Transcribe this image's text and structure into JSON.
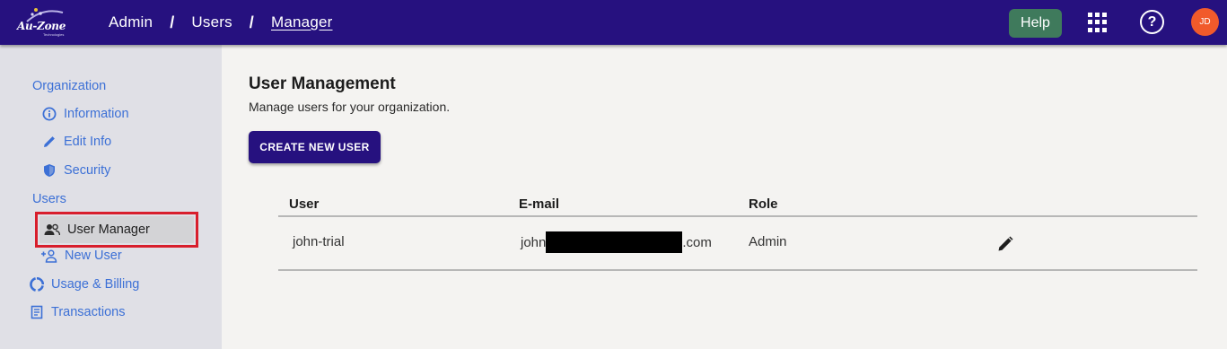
{
  "app": {
    "logo_text": "Au-Zone",
    "logo_sub": "Technologies"
  },
  "breadcrumb": {
    "items": [
      "Admin",
      "Users",
      "Manager"
    ],
    "separator": "/"
  },
  "header": {
    "help_label": "Help",
    "question_glyph": "?",
    "avatar_initials": "JD",
    "colors": {
      "bar": "#26117f",
      "help": "#3f7a5c",
      "avatar": "#f15a2b"
    }
  },
  "sidebar": {
    "groups": [
      {
        "label": "Organization",
        "items": [
          {
            "label": "Information",
            "icon": "info-circle-icon"
          },
          {
            "label": "Edit Info",
            "icon": "pencil-icon"
          },
          {
            "label": "Security",
            "icon": "shield-icon"
          }
        ]
      },
      {
        "label": "Users",
        "items": [
          {
            "label": "User Manager",
            "icon": "people-icon",
            "active": true
          },
          {
            "label": "New User",
            "icon": "add-person-icon"
          }
        ]
      }
    ],
    "extra_items": [
      {
        "label": "Usage & Billing",
        "icon": "donut-chart-icon"
      },
      {
        "label": "Transactions",
        "icon": "receipt-icon"
      }
    ]
  },
  "main": {
    "title": "User Management",
    "subtitle": "Manage users for your organization.",
    "create_button": "CREATE NEW USER",
    "table": {
      "columns": [
        "User",
        "E-mail",
        "Role"
      ],
      "rows": [
        {
          "user": "john-trial",
          "email_prefix": "john",
          "email_suffix": ".com",
          "role": "Admin"
        }
      ]
    }
  }
}
